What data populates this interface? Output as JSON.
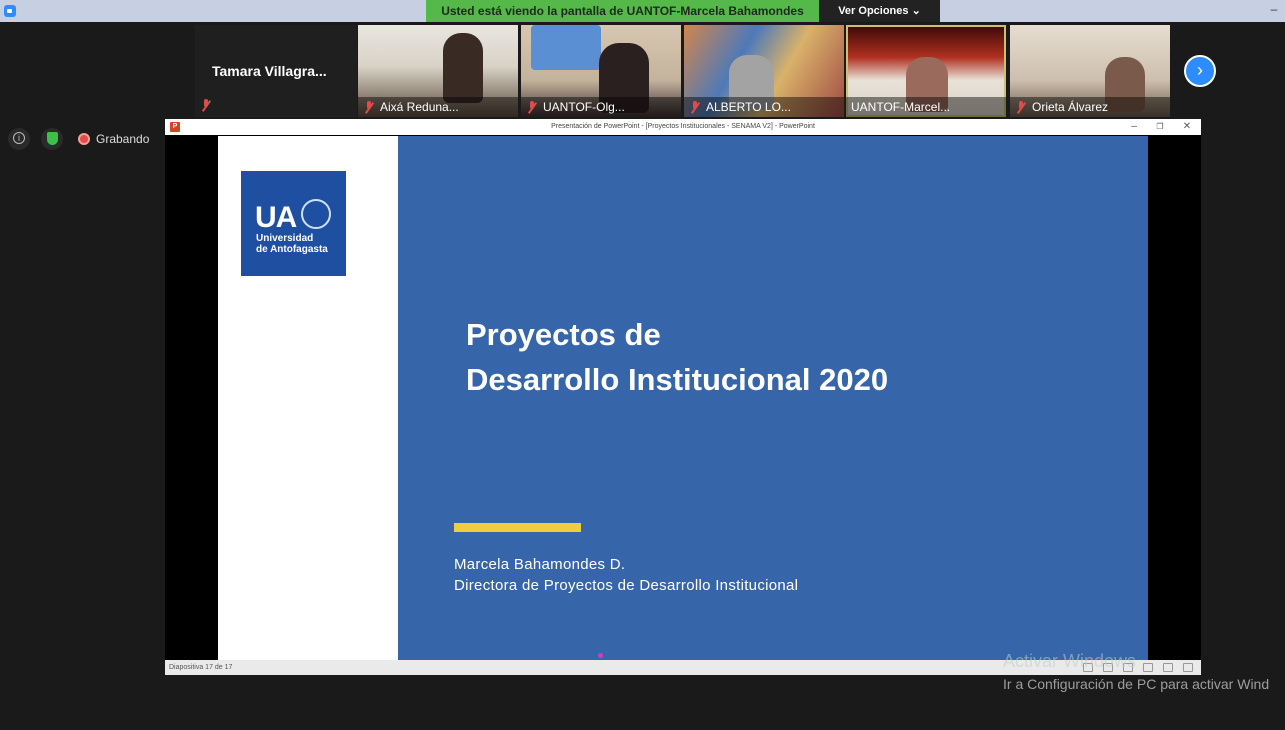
{
  "zoom": {
    "share_banner": "Usted está viendo la pantalla de UANTOF-Marcela Bahamondes",
    "view_options": "Ver Opciones",
    "minimize_symbol": "–",
    "next_symbol": "›",
    "info_symbol": "i",
    "recording_label": "Grabando",
    "participants": [
      {
        "name": "Tamara  Villagra...",
        "muted": true,
        "video": false
      },
      {
        "name": "Aixá Reduna...",
        "muted": true,
        "video": true
      },
      {
        "name": "UANTOF-Olg...",
        "muted": true,
        "video": true
      },
      {
        "name": "ALBERTO LO...",
        "muted": true,
        "video": true
      },
      {
        "name": "UANTOF-Marcel...",
        "muted": false,
        "video": true,
        "active": true
      },
      {
        "name": "Orieta Álvarez",
        "muted": true,
        "video": true
      }
    ]
  },
  "ppt": {
    "icon_letter": "P",
    "window_title": "Presentación de PowerPoint - [Proyectos Institucionales - SENAMA V2] - PowerPoint",
    "window_controls": [
      "–",
      "❐",
      "✕"
    ],
    "status": "Diapositiva 17 de 17",
    "slide": {
      "logo_letters": "UA",
      "logo_line1": "Universidad",
      "logo_line2": "de Antofagasta",
      "title_line1": "Proyectos de",
      "title_line2": "Desarrollo Institucional 2020",
      "presenter_name": "Marcela Bahamondes D.",
      "presenter_role": "Directora de Proyectos de Desarrollo Institucional"
    }
  },
  "windows_watermark": {
    "line1": "Activar Windows",
    "line2": "Ir a Configuración de PC para activar Wind"
  },
  "colors": {
    "slide_blue": "#3665aa",
    "accent_yellow": "#f0ce3b",
    "zoom_green": "#55b94a",
    "zoom_blue": "#2d8cff"
  }
}
